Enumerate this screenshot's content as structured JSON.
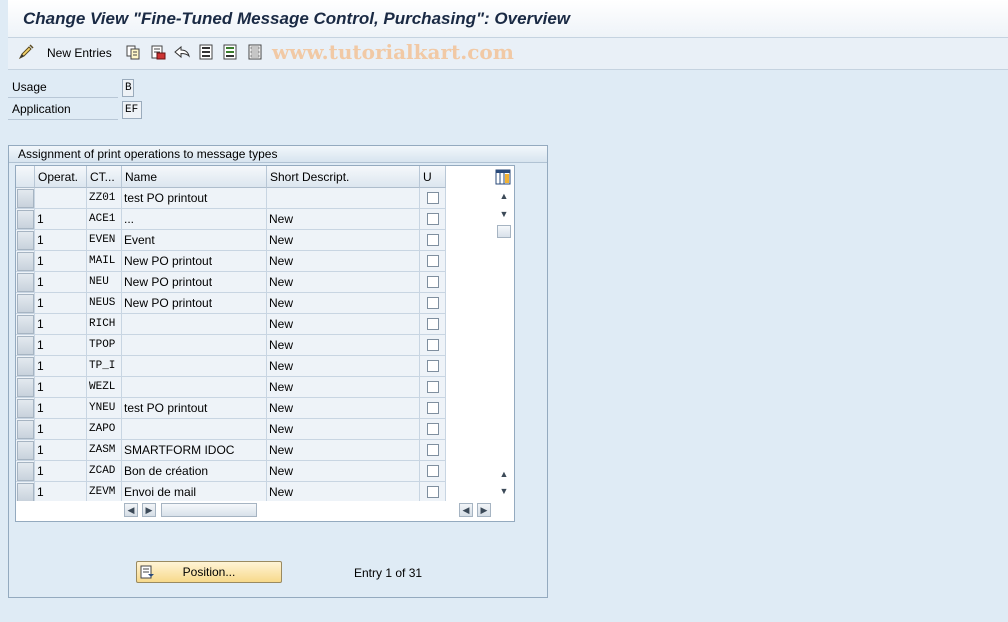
{
  "title": "Change View \"Fine-Tuned Message Control, Purchasing\": Overview",
  "toolbar": {
    "new_entries_label": "New Entries",
    "icons": [
      "change-display-icon",
      "copy-icon",
      "delete-icon",
      "undo-icon",
      "select-all-icon",
      "select-block-icon",
      "deselect-all-icon"
    ]
  },
  "watermark": "www.tutorialkart.com",
  "fields": {
    "usage_label": "Usage",
    "usage_value": "B",
    "application_label": "Application",
    "application_value": "EF"
  },
  "group": {
    "title": "Assignment of print operations to message types"
  },
  "table": {
    "columns": [
      "Operat.",
      "CT...",
      "Name",
      "Short Descript.",
      "U"
    ],
    "rows": [
      {
        "op": "",
        "ct": "ZZ01",
        "name": "test PO printout",
        "desc": ""
      },
      {
        "op": "1",
        "ct": "ACE1",
        "name": "...",
        "desc": "New"
      },
      {
        "op": "1",
        "ct": "EVEN",
        "name": "Event",
        "desc": "New"
      },
      {
        "op": "1",
        "ct": "MAIL",
        "name": "New PO printout",
        "desc": "New"
      },
      {
        "op": "1",
        "ct": "NEU",
        "name": "New PO printout",
        "desc": "New"
      },
      {
        "op": "1",
        "ct": "NEUS",
        "name": "New PO printout",
        "desc": "New"
      },
      {
        "op": "1",
        "ct": "RICH",
        "name": "",
        "desc": "New"
      },
      {
        "op": "1",
        "ct": "TPOP",
        "name": "",
        "desc": "New"
      },
      {
        "op": "1",
        "ct": "TP_I",
        "name": "",
        "desc": "New"
      },
      {
        "op": "1",
        "ct": "WEZL",
        "name": "",
        "desc": "New"
      },
      {
        "op": "1",
        "ct": "YNEU",
        "name": "test PO printout",
        "desc": "New"
      },
      {
        "op": "1",
        "ct": "ZAPO",
        "name": "",
        "desc": "New"
      },
      {
        "op": "1",
        "ct": "ZASM",
        "name": "SMARTFORM IDOC",
        "desc": "New"
      },
      {
        "op": "1",
        "ct": "ZCAD",
        "name": "Bon de création",
        "desc": "New"
      },
      {
        "op": "1",
        "ct": "ZEVM",
        "name": "Envoi de mail",
        "desc": "New"
      }
    ]
  },
  "position_button_label": "Position...",
  "entry_text": "Entry 1 of 31"
}
